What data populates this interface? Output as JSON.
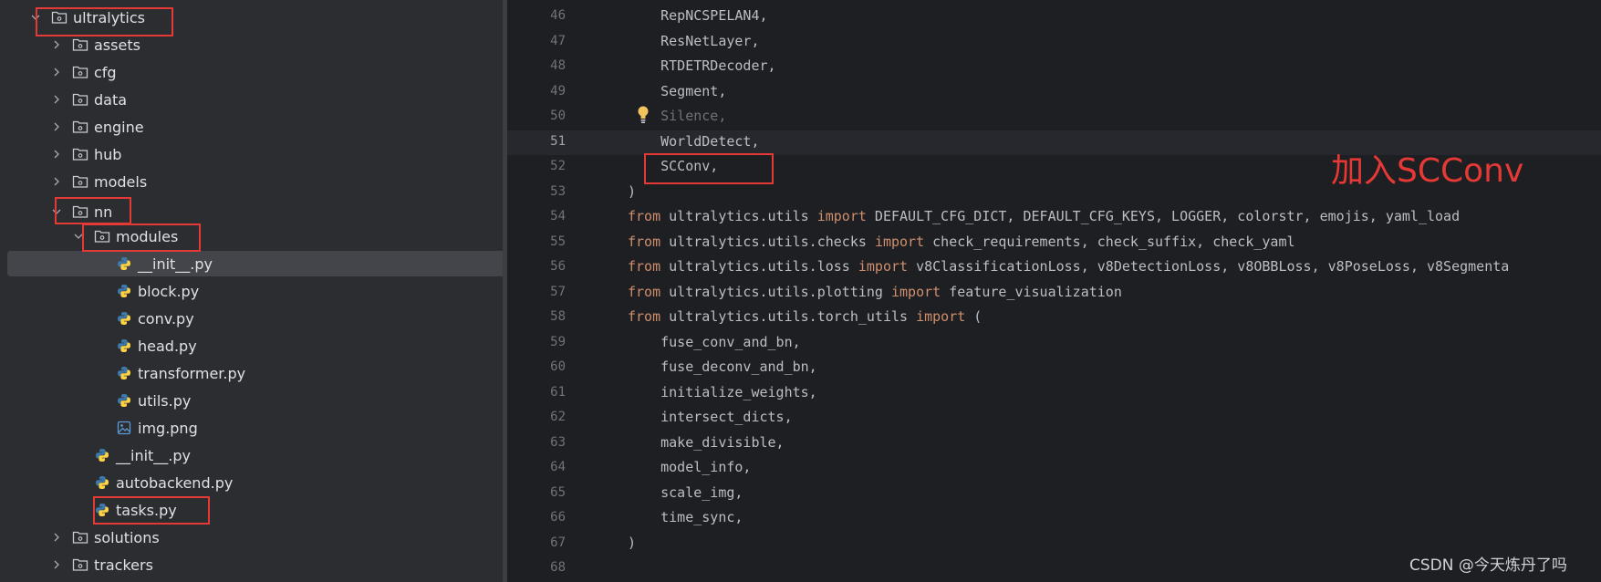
{
  "project_tree": {
    "root": "ultralytics",
    "root_children_top": [
      "assets",
      "cfg",
      "data",
      "engine",
      "hub",
      "models"
    ],
    "nn_folder": "nn",
    "modules_folder": "modules",
    "modules_files": [
      "__init__.py",
      "block.py",
      "conv.py",
      "head.py",
      "transformer.py",
      "utils.py",
      "img.png"
    ],
    "nn_files": [
      "__init__.py",
      "autobackend.py",
      "tasks.py"
    ],
    "root_children_bottom": [
      "solutions",
      "trackers"
    ],
    "selected_item": "__init__.py"
  },
  "editor": {
    "current_line": "51",
    "line_numbers": [
      "46",
      "47",
      "48",
      "49",
      "50",
      "51",
      "52",
      "53",
      "54",
      "55",
      "56",
      "57",
      "58",
      "59",
      "60",
      "61",
      "62",
      "63",
      "64",
      "65",
      "66",
      "67",
      "68"
    ],
    "code_lines": [
      {
        "indent": "    ",
        "text": "RepNCSPELAN4,"
      },
      {
        "indent": "    ",
        "text": "ResNetLayer,"
      },
      {
        "indent": "    ",
        "text": "RTDETRDecoder,"
      },
      {
        "indent": "    ",
        "text": "Segment,"
      },
      {
        "indent": "    ",
        "text": "Silence,"
      },
      {
        "indent": "    ",
        "text": "WorldDetect,"
      },
      {
        "indent": "    ",
        "text": "SCConv,"
      },
      {
        "indent": "",
        "text": ")"
      },
      {
        "kw1": "from",
        "module": " ultralytics.utils ",
        "kw2": "import",
        "names": " DEFAULT_CFG_DICT, DEFAULT_CFG_KEYS, LOGGER, colorstr, emojis, yaml_load"
      },
      {
        "kw1": "from",
        "module": " ultralytics.utils.checks ",
        "kw2": "import",
        "names": " check_requirements, check_suffix, check_yaml"
      },
      {
        "kw1": "from",
        "module": " ultralytics.utils.loss ",
        "kw2": "import",
        "names": " v8ClassificationLoss, v8DetectionLoss, v8OBBLoss, v8PoseLoss, v8Segmenta"
      },
      {
        "kw1": "from",
        "module": " ultralytics.utils.plotting ",
        "kw2": "import",
        "names": " feature_visualization"
      },
      {
        "kw1": "from",
        "module": " ultralytics.utils.torch_utils ",
        "kw2": "import",
        "names": " ("
      },
      {
        "indent": "    ",
        "text": "fuse_conv_and_bn,"
      },
      {
        "indent": "    ",
        "text": "fuse_deconv_and_bn,"
      },
      {
        "indent": "    ",
        "text": "initialize_weights,"
      },
      {
        "indent": "    ",
        "text": "intersect_dicts,"
      },
      {
        "indent": "    ",
        "text": "make_divisible,"
      },
      {
        "indent": "    ",
        "text": "model_info,"
      },
      {
        "indent": "    ",
        "text": "scale_img,"
      },
      {
        "indent": "    ",
        "text": "time_sync,"
      },
      {
        "indent": "",
        "text": ")"
      },
      {
        "indent": "",
        "text": ""
      }
    ]
  },
  "annotations": {
    "callout": "加入SCConv",
    "watermark": "CSDN @今天炼丹了吗"
  },
  "colors": {
    "annotation_red": "#e53935",
    "keyword": "#cf8e6d",
    "python_blue": "#3c78aa",
    "python_yellow": "#ffd343",
    "bulb_yellow": "#f2c55c"
  }
}
